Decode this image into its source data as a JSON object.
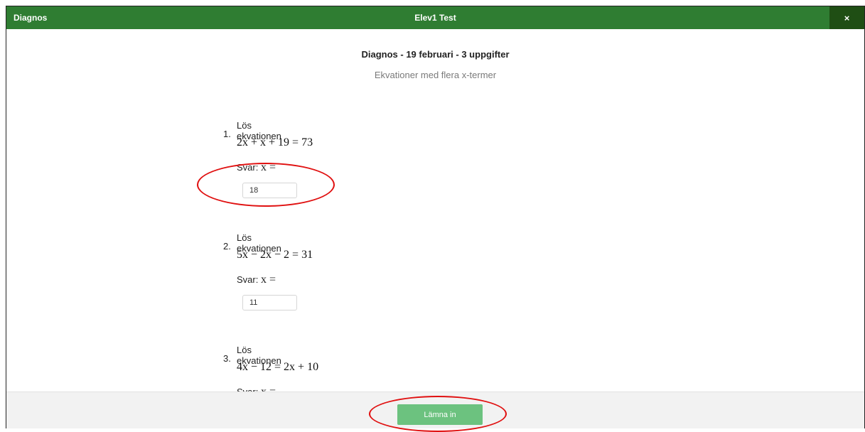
{
  "header": {
    "app_name": "Diagnos",
    "user_name": "Elev1 Test",
    "close_label": "×"
  },
  "page": {
    "title": "Diagnos - 19 februari - 3 uppgifter",
    "subtitle": "Ekvationer med flera x-termer"
  },
  "tasks": [
    {
      "number": "1.",
      "prompt": "Lös ekvationen",
      "equation": "2x + x + 19 = 73",
      "answer_label": "Svar:",
      "answer_var": "x =",
      "answer_value": "18"
    },
    {
      "number": "2.",
      "prompt": "Lös ekvationen",
      "equation": "5x − 2x − 2 = 31",
      "answer_label": "Svar:",
      "answer_var": "x =",
      "answer_value": "11"
    },
    {
      "number": "3.",
      "prompt": "Lös ekvationen",
      "equation": "4x − 12 = 2x + 10",
      "answer_label": "Svar:",
      "answer_var": "x ="
    }
  ],
  "footer": {
    "submit_label": "Lämna in"
  },
  "colors": {
    "header_green": "#2f7d32",
    "close_bg": "#1f4e14",
    "submit_green": "#6cc27f",
    "annotation_red": "#e01010"
  }
}
